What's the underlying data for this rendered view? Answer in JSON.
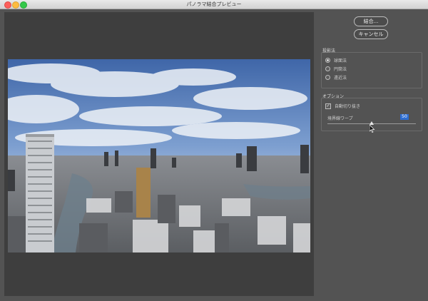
{
  "window": {
    "title": "パノラマ結合プレビュー"
  },
  "buttons": {
    "ok_label": "結合...",
    "cancel_label": "キャンセル"
  },
  "projection": {
    "title": "投影法",
    "options": [
      {
        "label": "球面法",
        "selected": true
      },
      {
        "label": "円筒法",
        "selected": false
      },
      {
        "label": "遠近法",
        "selected": false
      }
    ]
  },
  "options": {
    "title": "オプション",
    "auto_crop_label": "自動切り抜き",
    "auto_crop_checked": true,
    "boundary_warp_label": "境界線ワープ",
    "boundary_warp_value": "50",
    "boundary_warp_percent": 50
  },
  "icons": {
    "checkmark": "checkmark-icon",
    "cursor": "mouse-cursor-icon"
  }
}
